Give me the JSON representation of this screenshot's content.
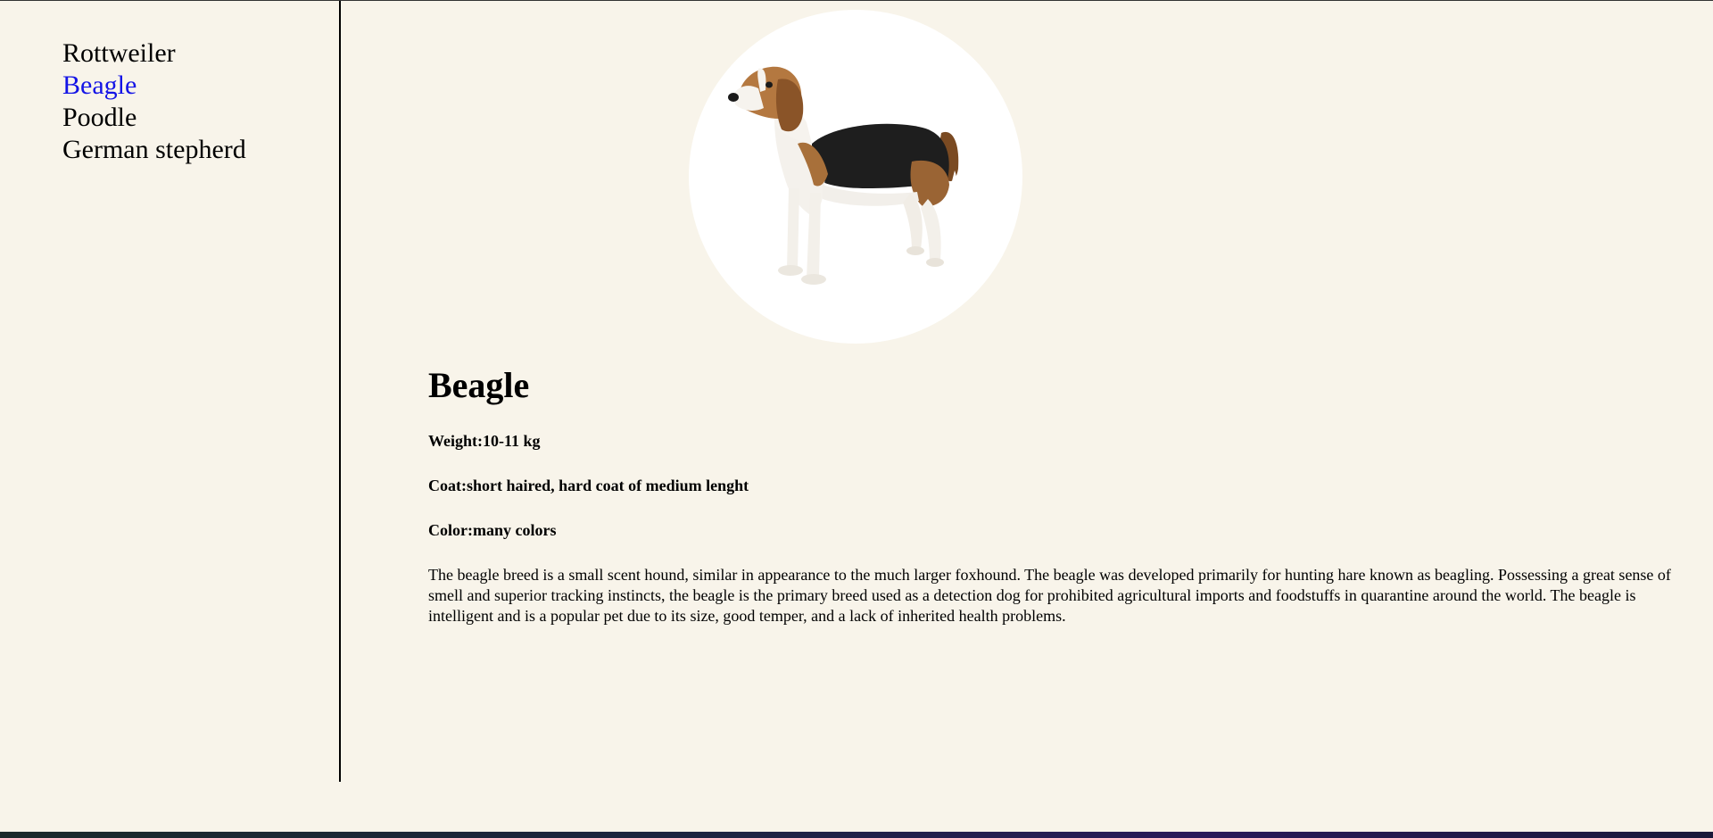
{
  "sidebar": {
    "items": [
      {
        "label": "Rottweiler",
        "active": false
      },
      {
        "label": "Beagle",
        "active": true
      },
      {
        "label": "Poodle",
        "active": false
      },
      {
        "label": "German stepherd",
        "active": false
      }
    ]
  },
  "main": {
    "photo_icon": "beagle-photo",
    "title": "Beagle",
    "weight": "Weight:10-11 kg",
    "coat": "Coat:short haired, hard coat of medium lenght",
    "color": "Color:many colors",
    "description": "The beagle breed is a small scent hound, similar in appearance to the much larger foxhound. The beagle was developed primarily for hunting hare known as beagling. Possessing a great sense of smell and superior tracking instincts, the beagle is the primary breed used as a detection dog for prohibited agricultural imports and foodstuffs in quarantine around the world. The beagle is intelligent and is a popular pet due to its size, good temper, and a lack of inherited health problems."
  },
  "colors": {
    "background": "#f8f4ea",
    "active_link": "#1414e6",
    "text": "#000000"
  }
}
